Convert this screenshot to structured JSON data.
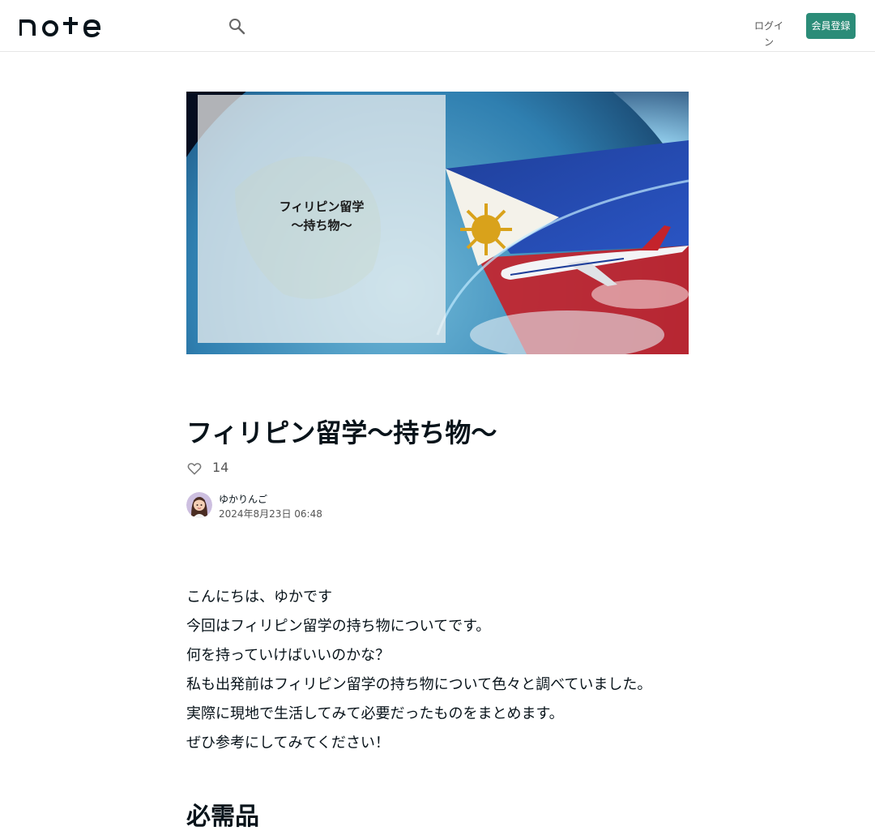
{
  "header": {
    "logo_text": "note",
    "search_icon": "search-icon",
    "login_label": "ログイン",
    "signup_label": "会員登録"
  },
  "hero": {
    "caption_line1": "フィリピン留学",
    "caption_line2": "〜持ち物〜"
  },
  "article": {
    "title": "フィリピン留学〜持ち物〜",
    "like_icon": "heart-outline-icon",
    "like_count": "14",
    "author_name": "ゆかりんご",
    "date": "2024年8月23日 06:48",
    "body_lines": [
      "こんにちは、ゆかです",
      "今回はフィリピン留学の持ち物についてです。",
      "何を持っていけばいいのかな？",
      "私も出発前はフィリピン留学の持ち物について色々と調べていました。",
      "実際に現地で生活してみて必要だったものをまとめます。",
      "ぜひ参考にしてみてください！"
    ],
    "section_heading": "必需品"
  },
  "colors": {
    "accent": "#2b8c78",
    "text": "#08131a",
    "muted": "#555555"
  }
}
